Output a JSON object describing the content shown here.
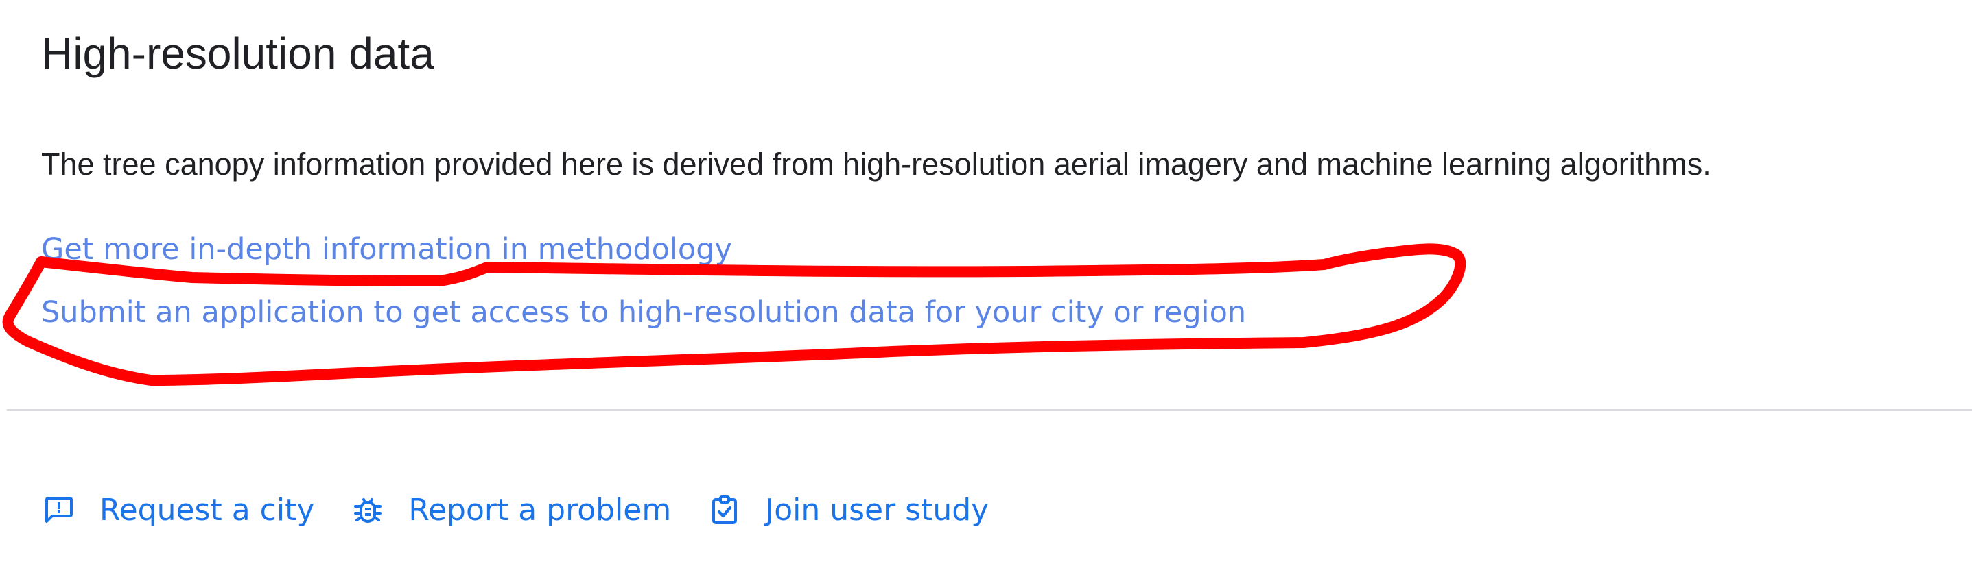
{
  "section": {
    "title": "High-resolution data",
    "description": "The tree canopy information provided here is derived from high-resolution aerial imagery and machine learning algorithms."
  },
  "links": {
    "methodology": "Get more in-depth information in methodology",
    "application": "Submit an application to get access to high-resolution data for your city or region"
  },
  "footer": {
    "items": [
      {
        "label": "Request a city",
        "icon": "feedback-icon"
      },
      {
        "label": "Report a problem",
        "icon": "bug-icon"
      },
      {
        "label": "Join user study",
        "icon": "checkbox-icon"
      }
    ]
  },
  "colors": {
    "link": "#5a85e6",
    "footer_link": "#1a73e8",
    "annotation": "#ff0000",
    "divider": "#dadce0"
  }
}
